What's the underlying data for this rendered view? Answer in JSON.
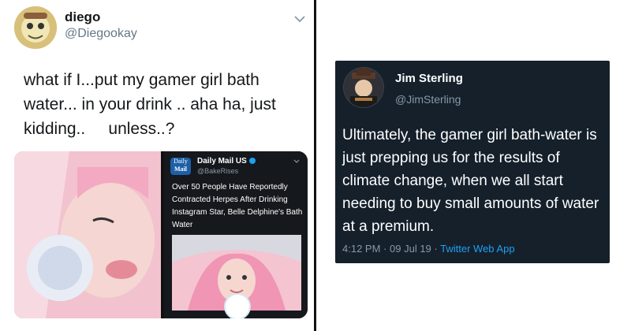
{
  "left_tweet": {
    "name": "diego",
    "handle": "@Diegookay",
    "text_lines": [
      "what if I...put my gamer girl bath",
      "water... in your drink .. aha ha, just",
      "kidding..     unless..?"
    ],
    "card": {
      "logo_top": "Daily",
      "logo_bottom": "Mail",
      "account_name": "Daily Mail US",
      "account_handle": "@BakeRises",
      "text": "Over 50 People Have Reportedly Contracted Herpes After Drinking Instagram Star, Belle Delphine's Bath Water"
    }
  },
  "right_tweet": {
    "name": "Jim Sterling",
    "handle": "@JimSterling",
    "text": "Ultimately, the gamer girl bath-water is just prepping us for the results of climate change, when we all start needing to buy small amounts of water at a premium.",
    "time": "4:12 PM",
    "date": "09 Jul 19",
    "app": "Twitter Web App",
    "sep": "·"
  },
  "colors": {
    "left_bg": "#ffffff",
    "right_card_bg": "#15202b",
    "accent": "#1da1f2",
    "divider": "#111111"
  }
}
